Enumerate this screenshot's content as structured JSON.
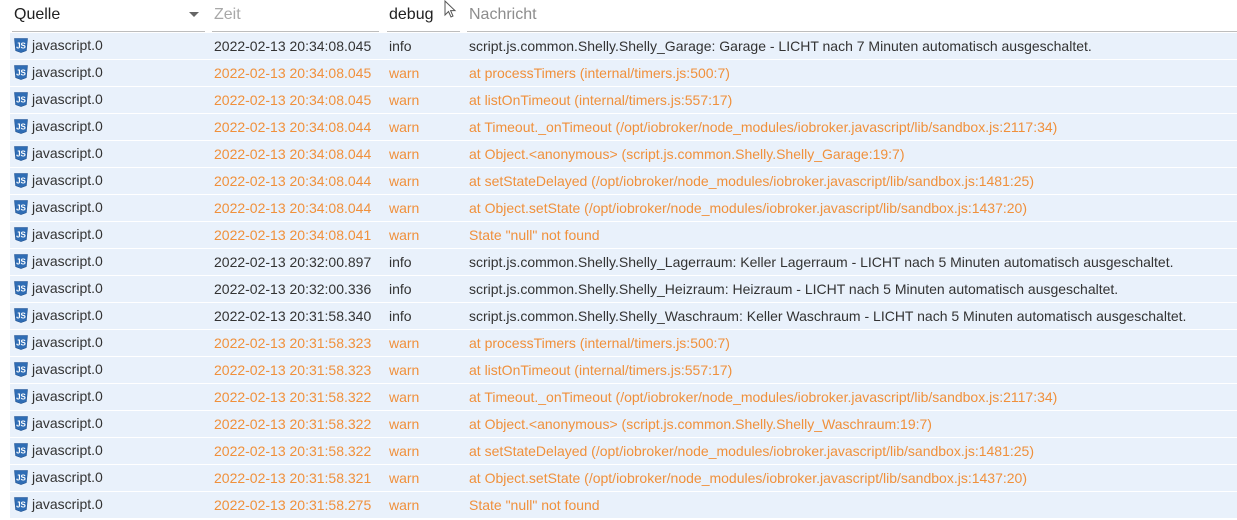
{
  "header": {
    "source_label": "Quelle",
    "time_label": "Zeit",
    "severity_label": "debug",
    "message_label": "Nachricht"
  },
  "colors": {
    "warn": "#f0903b",
    "info": "#333333",
    "row_bg": "#e9f1fb"
  },
  "source_icon": "javascript-adapter-icon",
  "rows": [
    {
      "source": "javascript.0",
      "time": "2022-02-13 20:34:08.045",
      "severity": "info",
      "message": "script.js.common.Shelly.Shelly_Garage: Garage - LICHT nach 7 Minuten automatisch ausgeschaltet."
    },
    {
      "source": "javascript.0",
      "time": "2022-02-13 20:34:08.045",
      "severity": "warn",
      "message": "at processTimers (internal/timers.js:500:7)"
    },
    {
      "source": "javascript.0",
      "time": "2022-02-13 20:34:08.045",
      "severity": "warn",
      "message": "at listOnTimeout (internal/timers.js:557:17)"
    },
    {
      "source": "javascript.0",
      "time": "2022-02-13 20:34:08.044",
      "severity": "warn",
      "message": "at Timeout._onTimeout (/opt/iobroker/node_modules/iobroker.javascript/lib/sandbox.js:2117:34)"
    },
    {
      "source": "javascript.0",
      "time": "2022-02-13 20:34:08.044",
      "severity": "warn",
      "message": "at Object.<anonymous> (script.js.common.Shelly.Shelly_Garage:19:7)"
    },
    {
      "source": "javascript.0",
      "time": "2022-02-13 20:34:08.044",
      "severity": "warn",
      "message": "at setStateDelayed (/opt/iobroker/node_modules/iobroker.javascript/lib/sandbox.js:1481:25)"
    },
    {
      "source": "javascript.0",
      "time": "2022-02-13 20:34:08.044",
      "severity": "warn",
      "message": "at Object.setState (/opt/iobroker/node_modules/iobroker.javascript/lib/sandbox.js:1437:20)"
    },
    {
      "source": "javascript.0",
      "time": "2022-02-13 20:34:08.041",
      "severity": "warn",
      "message": "State \"null\" not found"
    },
    {
      "source": "javascript.0",
      "time": "2022-02-13 20:32:00.897",
      "severity": "info",
      "message": "script.js.common.Shelly.Shelly_Lagerraum: Keller Lagerraum - LICHT nach 5 Minuten automatisch ausgeschaltet."
    },
    {
      "source": "javascript.0",
      "time": "2022-02-13 20:32:00.336",
      "severity": "info",
      "message": "script.js.common.Shelly.Shelly_Heizraum: Heizraum - LICHT nach 5 Minuten automatisch ausgeschaltet."
    },
    {
      "source": "javascript.0",
      "time": "2022-02-13 20:31:58.340",
      "severity": "info",
      "message": "script.js.common.Shelly.Shelly_Waschraum: Keller Waschraum - LICHT nach 5 Minuten automatisch ausgeschaltet."
    },
    {
      "source": "javascript.0",
      "time": "2022-02-13 20:31:58.323",
      "severity": "warn",
      "message": "at processTimers (internal/timers.js:500:7)"
    },
    {
      "source": "javascript.0",
      "time": "2022-02-13 20:31:58.323",
      "severity": "warn",
      "message": "at listOnTimeout (internal/timers.js:557:17)"
    },
    {
      "source": "javascript.0",
      "time": "2022-02-13 20:31:58.322",
      "severity": "warn",
      "message": "at Timeout._onTimeout (/opt/iobroker/node_modules/iobroker.javascript/lib/sandbox.js:2117:34)"
    },
    {
      "source": "javascript.0",
      "time": "2022-02-13 20:31:58.322",
      "severity": "warn",
      "message": "at Object.<anonymous> (script.js.common.Shelly.Shelly_Waschraum:19:7)"
    },
    {
      "source": "javascript.0",
      "time": "2022-02-13 20:31:58.322",
      "severity": "warn",
      "message": "at setStateDelayed (/opt/iobroker/node_modules/iobroker.javascript/lib/sandbox.js:1481:25)"
    },
    {
      "source": "javascript.0",
      "time": "2022-02-13 20:31:58.321",
      "severity": "warn",
      "message": "at Object.setState (/opt/iobroker/node_modules/iobroker.javascript/lib/sandbox.js:1437:20)"
    },
    {
      "source": "javascript.0",
      "time": "2022-02-13 20:31:58.275",
      "severity": "warn",
      "message": "State \"null\" not found"
    }
  ]
}
